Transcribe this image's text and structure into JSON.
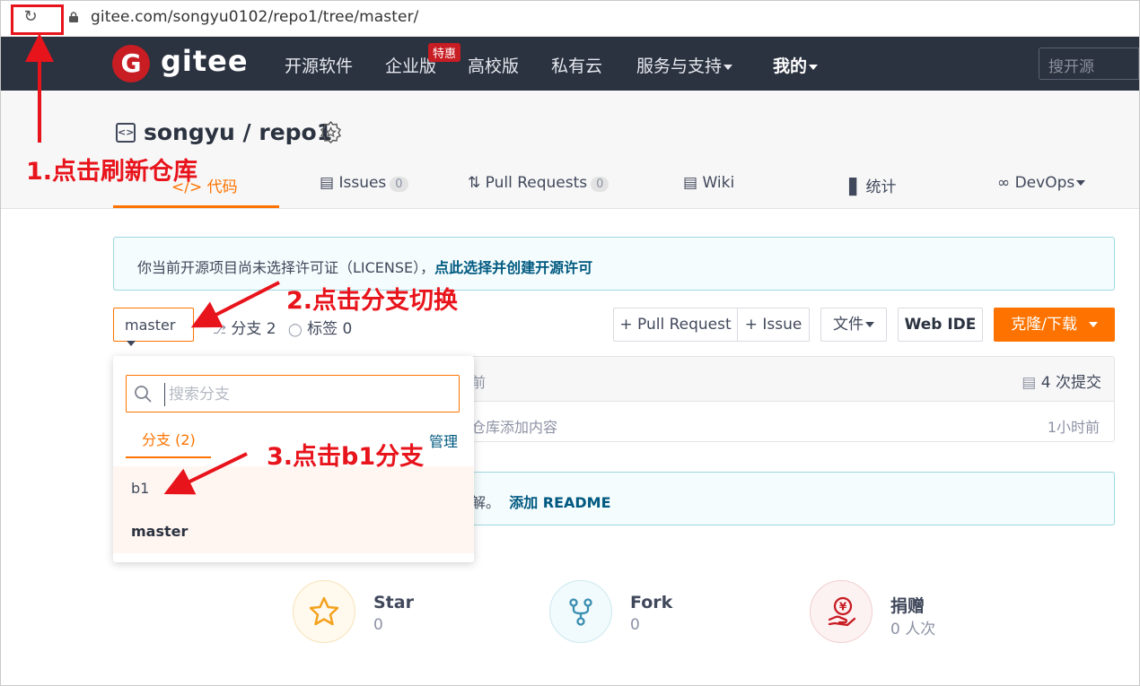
{
  "browser": {
    "url": "gitee.com/songyu0102/repo1/tree/master/"
  },
  "navbar": {
    "logo_letter": "G",
    "logo_text": "gitee",
    "items": [
      "开源软件",
      "企业版",
      "高校版",
      "私有云",
      "服务与支持",
      "我的"
    ],
    "hot_badge": "特惠",
    "search_placeholder": "搜开源"
  },
  "repo": {
    "title": "songyu / repo1",
    "tabs": {
      "code": "代码",
      "issues": "Issues",
      "issues_count": "0",
      "pulls": "Pull Requests",
      "pulls_count": "0",
      "wiki": "Wiki",
      "stats": "统计",
      "devops": "DevOps"
    }
  },
  "license_notice": {
    "text": "你当前开源项目尚未选择许可证（LICENSE），",
    "link": "点此选择并创建开源许可"
  },
  "branch_bar": {
    "current_branch": "master",
    "branches": "分支 2",
    "tags": "标签 0",
    "pull_request": "+ Pull Request",
    "issue": "+ Issue",
    "file": "文件",
    "web_ide": "Web IDE",
    "clone": "克隆/下载"
  },
  "commits": {
    "time_partial": "前",
    "count": "4 次提交",
    "file_message_partial": "仓库添加内容",
    "file_time": "1小时前"
  },
  "readme_notice": {
    "text_partial": "解。",
    "link": "添加 README"
  },
  "stats": {
    "star_label": "Star",
    "star_value": "0",
    "fork_label": "Fork",
    "fork_value": "0",
    "donate_label": "捐赠",
    "donate_value": "0 人次"
  },
  "branch_dropdown": {
    "search_placeholder": "搜索分支",
    "tab": "分支 (2)",
    "manage": "管理",
    "branches": [
      "b1",
      "master"
    ]
  },
  "annotations": {
    "step1": "1.点击刷新仓库",
    "step2": "2.点击分支切换",
    "step3": "3.点击b1分支"
  },
  "colors": {
    "brand_red": "#c71d23",
    "accent_orange": "#fe7300",
    "navbar_bg": "#2b3240",
    "annotation_red": "#e8141c",
    "link_blue": "#005980"
  },
  "icons": [
    "reload-icon",
    "lock-icon",
    "code-icon",
    "badge-icon",
    "issues-icon",
    "pull-request-icon",
    "wiki-icon",
    "stats-icon",
    "devops-icon",
    "branch-icon",
    "tag-icon",
    "commit-icon",
    "search-icon",
    "star-icon",
    "fork-icon",
    "donate-icon"
  ]
}
